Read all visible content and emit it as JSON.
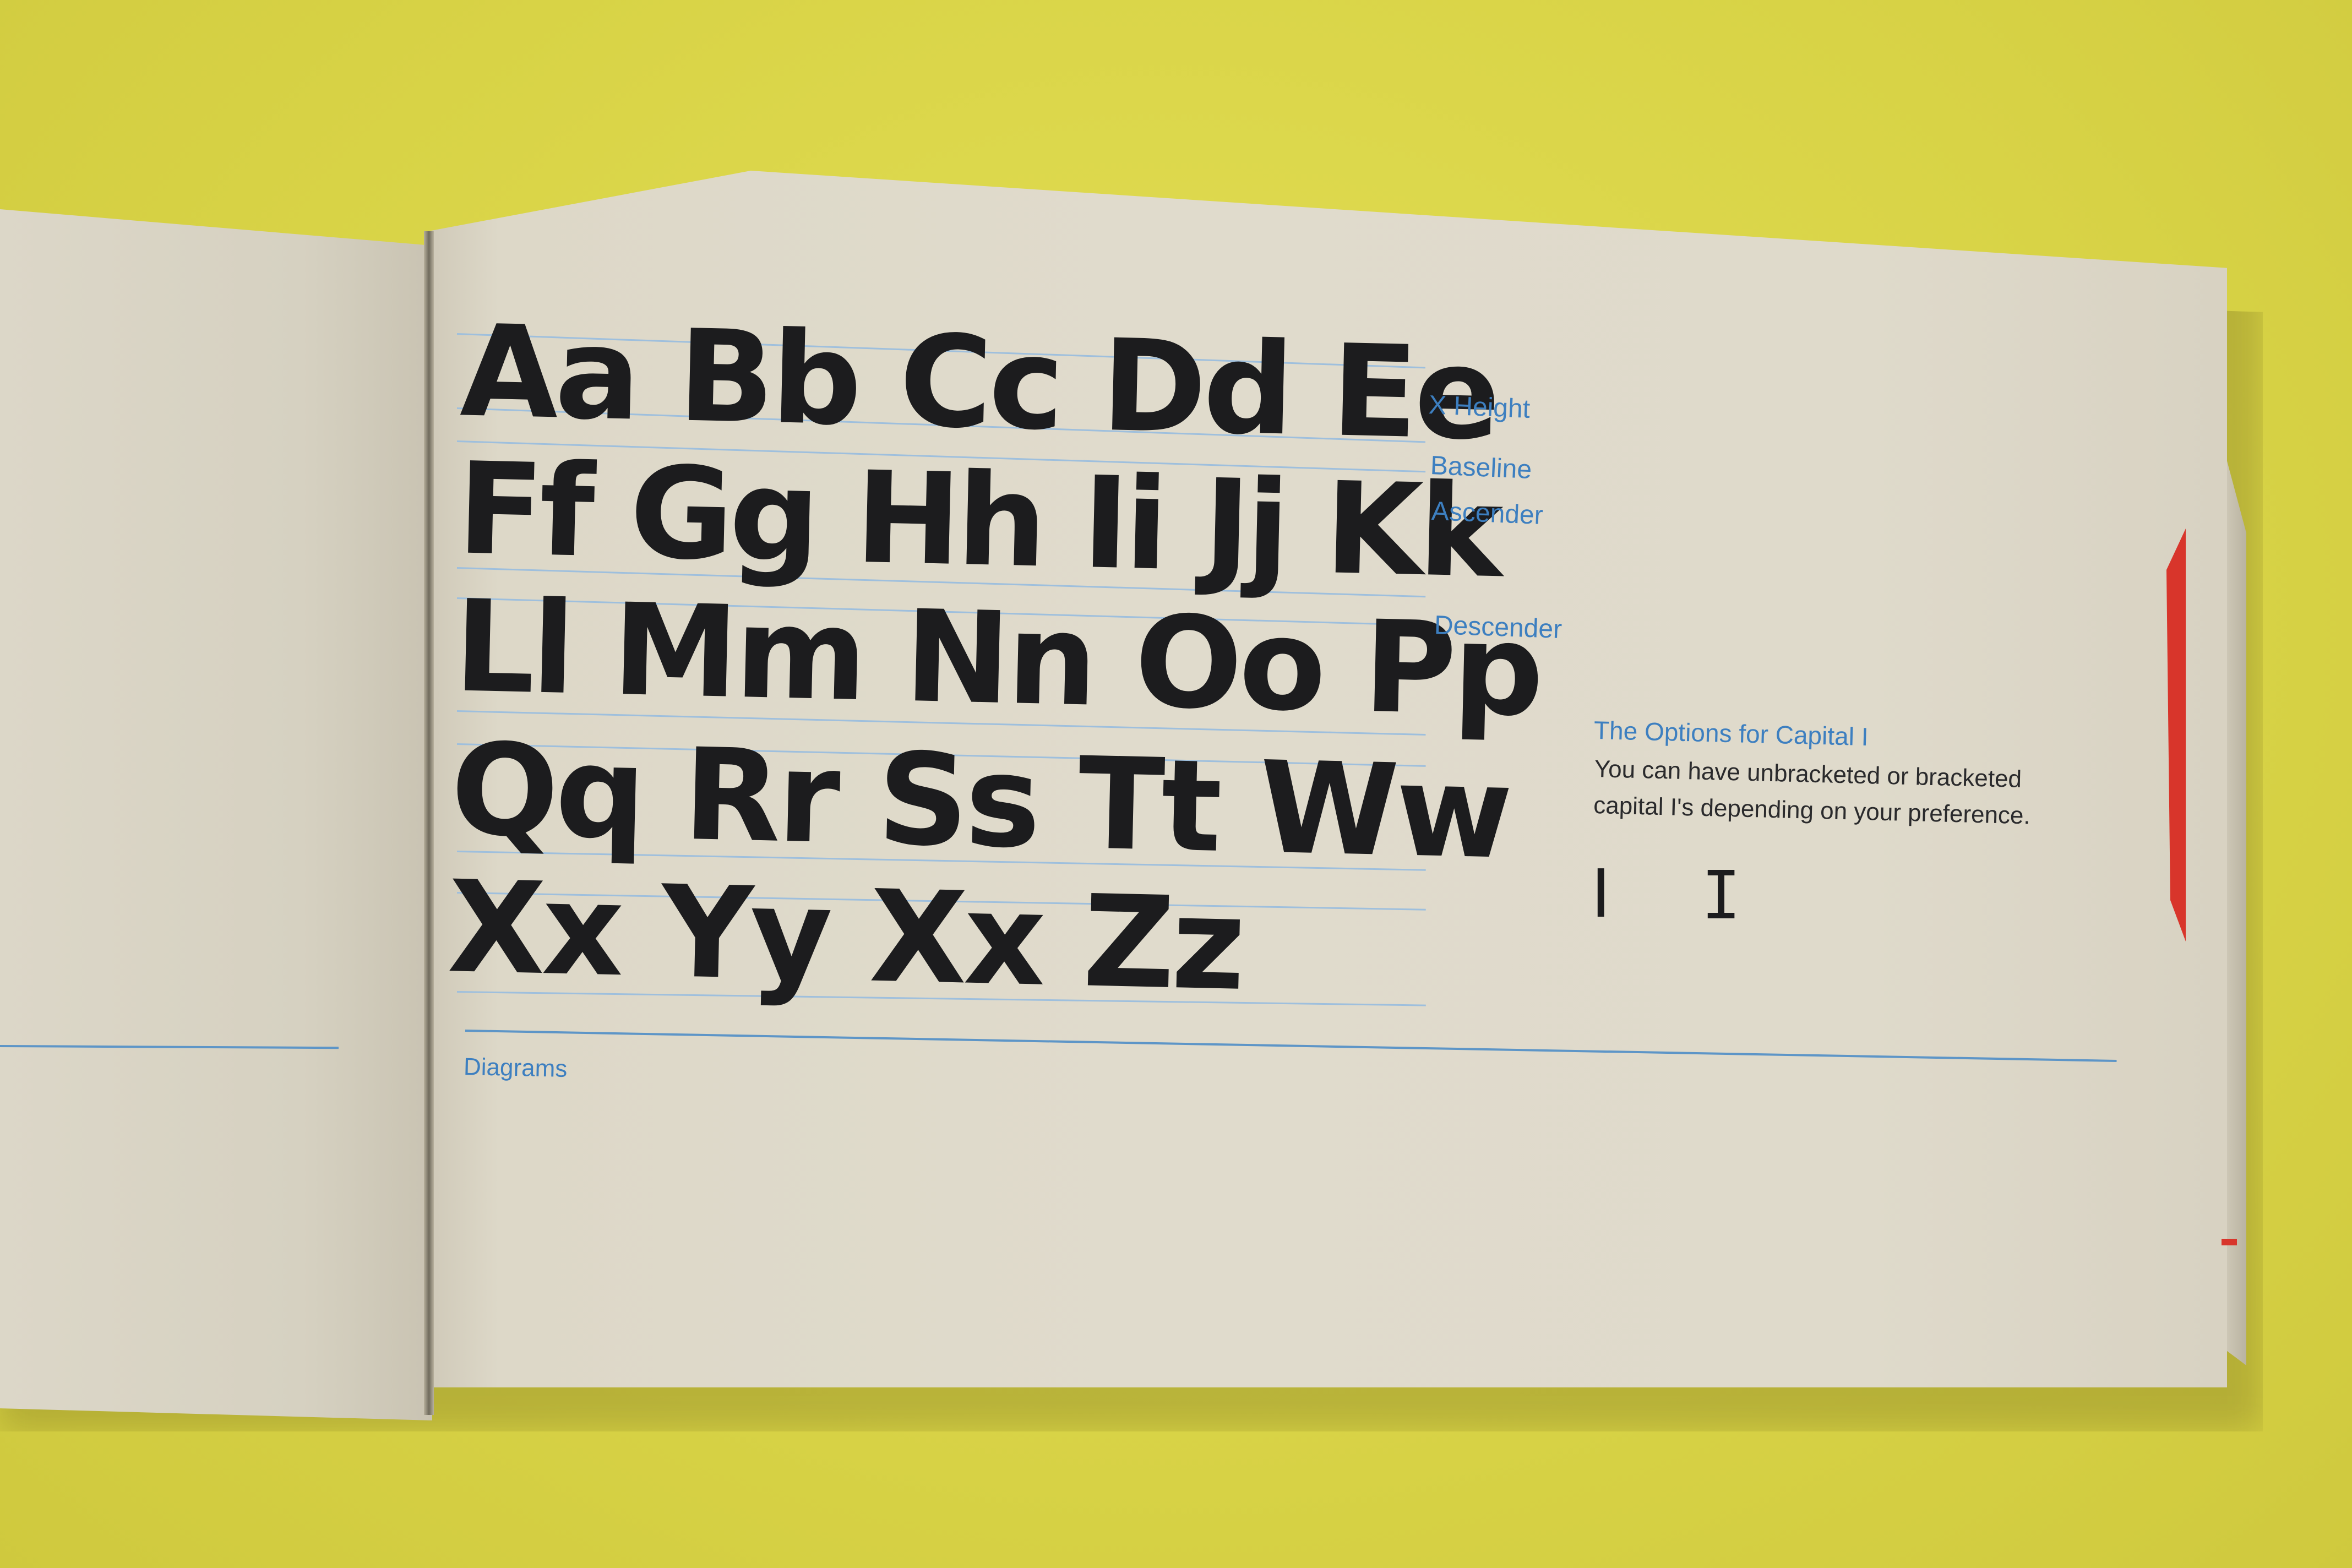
{
  "specimen": {
    "rows": [
      "Aa Bb Cc Dd Ee",
      "Ff Gg Hh Ii Jj Kk",
      "Ll Mm Nn Oo Pp",
      "Qq Rr Ss Tt Ww",
      "Xx Yy Xx Zz"
    ]
  },
  "diagram_labels": {
    "x_height": "X Height",
    "baseline": "Baseline",
    "ascender": "Ascender",
    "descender": "Descender"
  },
  "section_label": "Diagrams",
  "capital_note": {
    "heading": "The Options for Capital I",
    "body": "You can have unbracketed or bracketed capital I's depending on your preference.",
    "glyph_unbracketed": "I",
    "glyph_bracketed": "I"
  },
  "colors": {
    "background": "#dcd84a",
    "paper": "#e0dbcc",
    "accent_blue": "#3d7fc0",
    "ink": "#1c1c1e",
    "tab_red": "#d8352b"
  }
}
